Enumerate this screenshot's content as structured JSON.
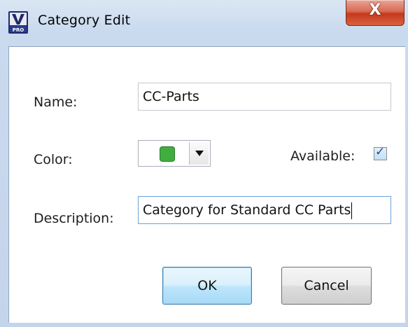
{
  "window": {
    "title": "Category Edit",
    "close_glyph": "X",
    "icon": "vpro-app-icon"
  },
  "form": {
    "name_label": "Name:",
    "name_value": "CC-Parts",
    "color_label": "Color:",
    "color_value": "#3fae3f",
    "available_label": "Available:",
    "available_checked": true,
    "check_glyph": "✓",
    "description_label": "Description:",
    "description_value": "Category for Standard CC Parts"
  },
  "buttons": {
    "ok": "OK",
    "cancel": "Cancel"
  }
}
